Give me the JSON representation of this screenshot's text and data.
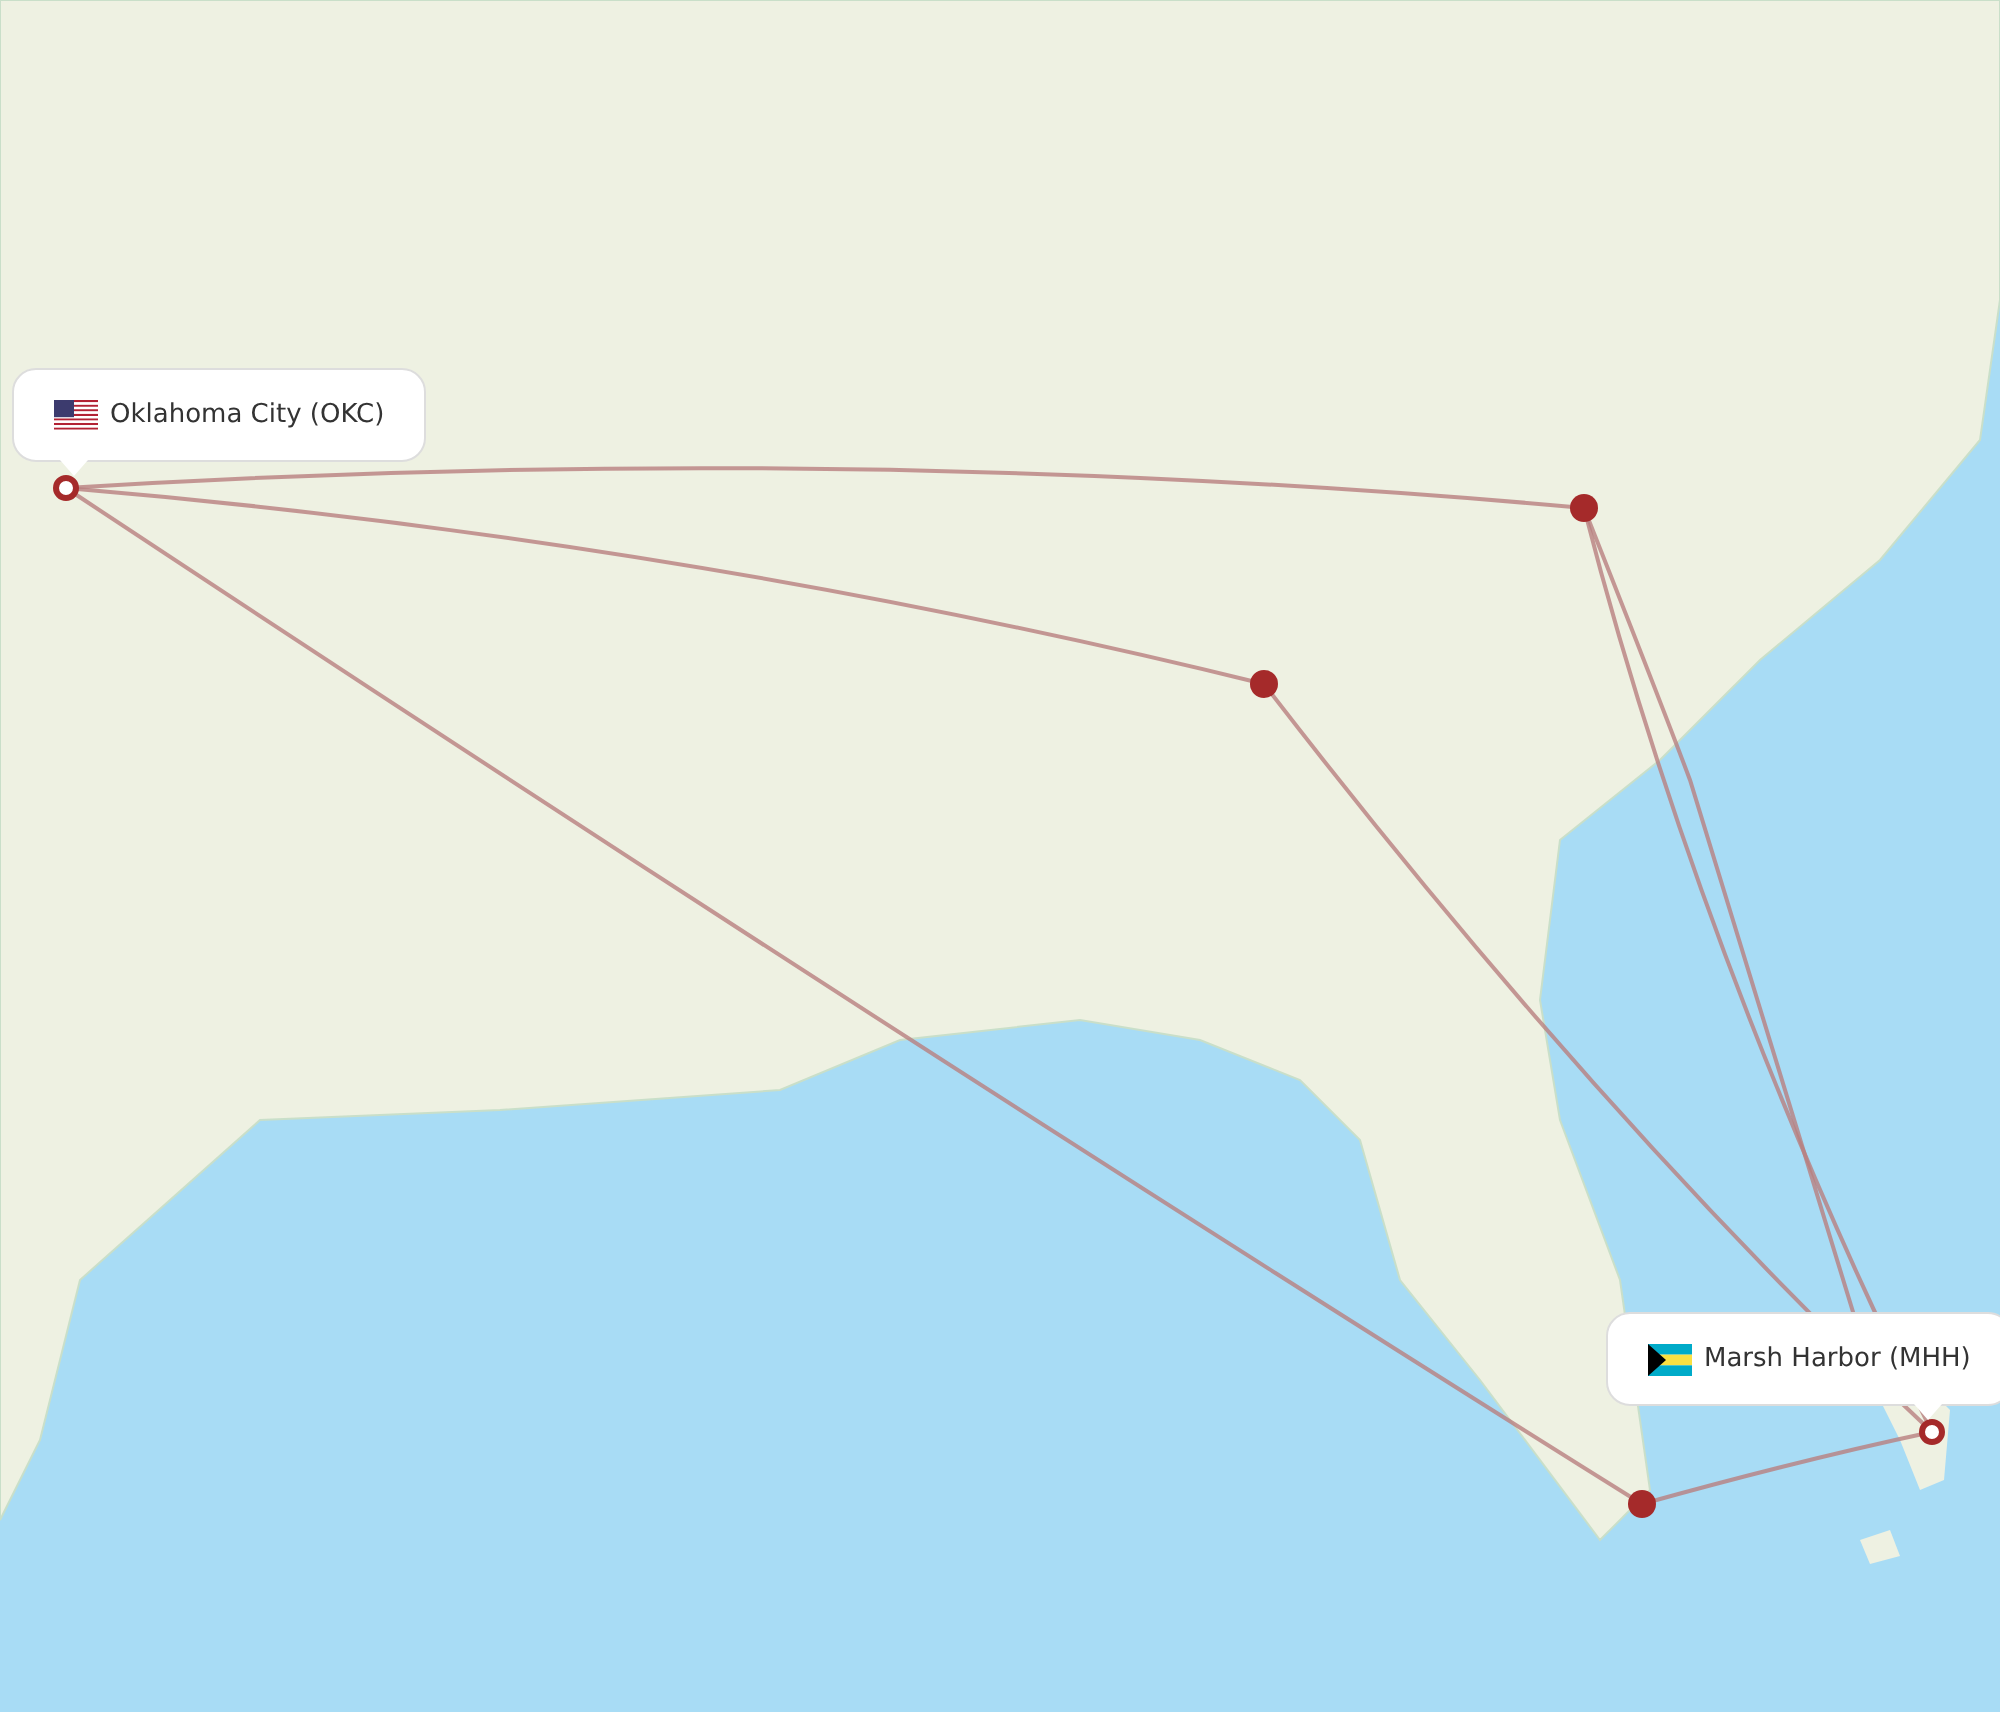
{
  "callouts": [
    {
      "label": "Oklahoma City (OKC)",
      "kind": "origin"
    },
    {
      "label": "Marsh Harbor (MHH)",
      "kind": "destination"
    }
  ]
}
